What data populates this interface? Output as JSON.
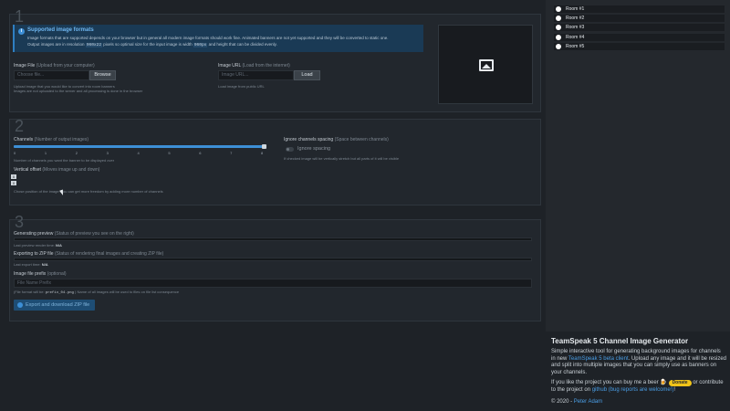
{
  "sections": {
    "s1": {
      "number": "1"
    },
    "s2": {
      "number": "2"
    },
    "s3": {
      "number": "3"
    }
  },
  "info": {
    "title": "Supported image formats",
    "line1": "Image formats that are supported depends on your browser but in general all modern image formats should work fine. Animated banners are not yet supported and they will be converted to static one.",
    "line2_prefix": "Output images are in resolution",
    "line2_code1": "960x22",
    "line2_mid": "pixels so optimal size for the input image is width",
    "line2_code2": "960px",
    "line2_suffix": "and height that can be divided evenly."
  },
  "image_file": {
    "label": "Image File",
    "sub": "(Upload from your computer)",
    "placeholder": "Choose file...",
    "button": "Browse",
    "hint1": "Upload image that you would like to convert into room banners",
    "hint2": "Images are not uploaded to the server and all processing is done in the browser"
  },
  "image_url": {
    "label": "Image URL",
    "sub": "(Load from the internet)",
    "placeholder": "Image URL...",
    "button": "Load",
    "hint": "Load image from public URL"
  },
  "channels": {
    "label": "Channels",
    "sub": "(Number of output images)",
    "ticks": [
      "0",
      "1",
      "2",
      "3",
      "4",
      "5",
      "6",
      "7",
      "8"
    ],
    "value": 8,
    "max": 8,
    "hint": "Number of channels you want the banner to be displayed over"
  },
  "spacing": {
    "label": "Ignore channels spacing",
    "sub": "(Space between channels)",
    "toggle_label": "Ignore spacing",
    "toggle_on": false,
    "hint": "If checked image will be vertically stretch but all parts of it will be visible"
  },
  "vertical_offset": {
    "label": "Vertical offset",
    "sub": "(Moves image up and down)",
    "value_top": "0",
    "value_bottom": "0",
    "hint": "Chose position of the image. You can get more freedom by adding more number of channels"
  },
  "generating": {
    "label": "Generating preview",
    "sub": "(Status of preview you see on the right)",
    "last_label": "Last preview render time:",
    "last_value": "N/A"
  },
  "exporting": {
    "label": "Exporting to ZIP file",
    "sub": "(Status of rendering final images and creating ZIP file)",
    "last_label": "Last export time:",
    "last_value": "N/A"
  },
  "prefix": {
    "label": "Image file prefix",
    "sub": "(optional)",
    "placeholder": "File Name Prefix",
    "hint_prefix": "(File format will be:",
    "hint_code": "prefix_04.png",
    "hint_suffix": ") Name of all images will be used to files on file list consequence"
  },
  "export_button": "Export and download ZIP file",
  "rooms": [
    "Room #1",
    "Room #2",
    "Room #3",
    "Room #4",
    "Room #5"
  ],
  "about": {
    "title": "TeamSpeak 5 Channel Image Generator",
    "p1_a": "Simple interactive tool for generating background images for channels in new",
    "p1_link": "TeamSpeak 5 beta client",
    "p1_b": ". Upload any image and it will be resized and split into multiple images that you can simply use as banners on your channels.",
    "p2_a": "If you like the project you can buy me a beer",
    "donate": "Donate",
    "p2_b": "or contribute to the project on",
    "p2_link": "github (bug reports are welcome!)",
    "p2_c": "!",
    "copy": "© 2020 -",
    "author": "Peter Adam"
  },
  "colors": {
    "accent": "#3d8fd6",
    "donate": "#f0c419",
    "info_bg": "#1a3a55"
  }
}
